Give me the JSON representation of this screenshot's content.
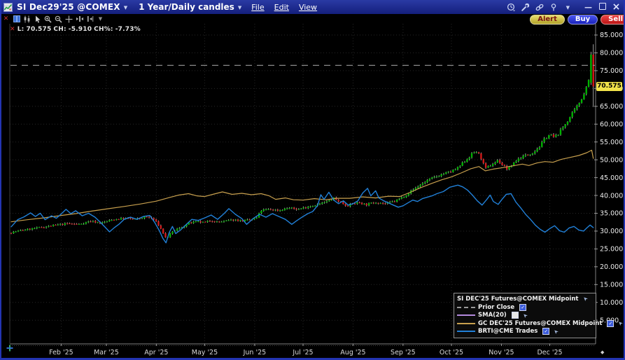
{
  "window": {
    "symbol": "SI Dec29'25 @COMEX",
    "timeframe": "1 Year/Daily candles",
    "menus": [
      "File",
      "Edit",
      "View"
    ],
    "alert_label": "Alert",
    "buy_label": "Buy",
    "sell_label": "Sell"
  },
  "quote": {
    "close_label": "L:",
    "close": "70.575",
    "change_label": "CH:",
    "change": "-5.910",
    "change_pct_label": "CH%:",
    "change_pct": "-7.73%"
  },
  "last_price_tag": "70.575",
  "legend": {
    "title": "SI DEC'25 Futures@COMEX Midpoint",
    "items": [
      {
        "label": "Prior Close",
        "color": "#9a9a9a",
        "dashed": true,
        "checkbox": true,
        "checked": true,
        "arrow": false
      },
      {
        "label": "SMA(20)",
        "color": "#b48ade",
        "dashed": false,
        "checkbox": true,
        "checked": false,
        "arrow": true
      },
      {
        "label": "GC DEC'25 Futures@COMEX Midpoint",
        "color": "#c8a04e",
        "dashed": false,
        "checkbox": true,
        "checked": true,
        "arrow": true
      },
      {
        "label": "BRTI@CME Trades",
        "color": "#2180d8",
        "dashed": false,
        "checkbox": true,
        "checked": true,
        "arrow": true
      }
    ]
  },
  "chart_data": {
    "type": "candlestick",
    "title": "SI Dec29'25 @COMEX - 1 Year/Daily candles",
    "last": 70.575,
    "change": -5.91,
    "change_pct": -7.73,
    "prior_close": 76.485,
    "ylim": [
      0,
      88
    ],
    "y_ticks": [
      85,
      80,
      75,
      70,
      65,
      60,
      55,
      50,
      45,
      40,
      35,
      30,
      25,
      20,
      15,
      10,
      5
    ],
    "x_ticks": [
      {
        "day": 31,
        "label": "Feb '25"
      },
      {
        "day": 59,
        "label": "Mar '25"
      },
      {
        "day": 90,
        "label": "Apr '25"
      },
      {
        "day": 120,
        "label": "May '25"
      },
      {
        "day": 151,
        "label": "Jun '25"
      },
      {
        "day": 181,
        "label": "Jul '25"
      },
      {
        "day": 212,
        "label": "Aug '25"
      },
      {
        "day": 243,
        "label": "Sep '25"
      },
      {
        "day": 273,
        "label": "Oct '25"
      },
      {
        "day": 304,
        "label": "Nov '25"
      },
      {
        "day": 334,
        "label": "Dec '25"
      }
    ],
    "colors": {
      "up": "#00b300",
      "down": "#d21a1a",
      "wick": "#c8c8c8",
      "gc": "#c8a04e",
      "brti": "#2180d8",
      "prior": "#9a9a9a",
      "sma": "#b48ade"
    },
    "si_close_anchors": [
      [
        0,
        29.6
      ],
      [
        6,
        30.2
      ],
      [
        12,
        30.6
      ],
      [
        18,
        31.0
      ],
      [
        24,
        31.4
      ],
      [
        28,
        31.7
      ],
      [
        35,
        32.1
      ],
      [
        42,
        31.9
      ],
      [
        49,
        32.8
      ],
      [
        56,
        32.3
      ],
      [
        63,
        33.2
      ],
      [
        70,
        33.6
      ],
      [
        77,
        33.3
      ],
      [
        84,
        34.0
      ],
      [
        88,
        33.5
      ],
      [
        91,
        32.0
      ],
      [
        94,
        29.7
      ],
      [
        96,
        27.9
      ],
      [
        99,
        29.3
      ],
      [
        102,
        30.4
      ],
      [
        106,
        31.1
      ],
      [
        110,
        32.2
      ],
      [
        115,
        32.6
      ],
      [
        120,
        32.4
      ],
      [
        124,
        33.0
      ],
      [
        128,
        32.5
      ],
      [
        133,
        32.8
      ],
      [
        138,
        33.2
      ],
      [
        143,
        32.9
      ],
      [
        148,
        33.1
      ],
      [
        152,
        33.6
      ],
      [
        155,
        35.8
      ],
      [
        160,
        36.1
      ],
      [
        166,
        35.8
      ],
      [
        172,
        36.5
      ],
      [
        178,
        36.1
      ],
      [
        184,
        36.9
      ],
      [
        190,
        37.4
      ],
      [
        196,
        38.3
      ],
      [
        200,
        39.2
      ],
      [
        204,
        38.2
      ],
      [
        208,
        37.1
      ],
      [
        212,
        37.7
      ],
      [
        216,
        38.0
      ],
      [
        220,
        37.4
      ],
      [
        226,
        38.1
      ],
      [
        232,
        37.7
      ],
      [
        238,
        38.4
      ],
      [
        243,
        39.6
      ],
      [
        248,
        41.2
      ],
      [
        253,
        42.8
      ],
      [
        258,
        44.2
      ],
      [
        263,
        45.2
      ],
      [
        268,
        46.1
      ],
      [
        273,
        46.7
      ],
      [
        277,
        47.7
      ],
      [
        281,
        49.5
      ],
      [
        285,
        51.3
      ],
      [
        288,
        52.5
      ],
      [
        291,
        51.0
      ],
      [
        294,
        47.4
      ],
      [
        298,
        48.7
      ],
      [
        302,
        49.9
      ],
      [
        305,
        48.4
      ],
      [
        308,
        47.2
      ],
      [
        312,
        49.4
      ],
      [
        316,
        50.7
      ],
      [
        320,
        51.4
      ],
      [
        324,
        52.2
      ],
      [
        328,
        53.9
      ],
      [
        331,
        56.0
      ],
      [
        334,
        57.1
      ],
      [
        337,
        56.2
      ],
      [
        340,
        57.8
      ],
      [
        343,
        59.6
      ],
      [
        346,
        61.6
      ],
      [
        349,
        63.6
      ],
      [
        351,
        65.0
      ],
      [
        353,
        66.6
      ],
      [
        355,
        68.4
      ],
      [
        357,
        70.8
      ],
      [
        358,
        72.5
      ],
      [
        359,
        75.5
      ],
      [
        360,
        78.0
      ],
      [
        361,
        70.575
      ]
    ],
    "final_candles": [
      {
        "o": 71.6,
        "h": 80.3,
        "l": 71.0,
        "c": 79.5
      },
      {
        "o": 79.5,
        "h": 82.4,
        "l": 64.8,
        "c": 70.575
      }
    ],
    "gc_line": [
      [
        0,
        32.6
      ],
      [
        10,
        33.2
      ],
      [
        20,
        33.7
      ],
      [
        31,
        34.4
      ],
      [
        40,
        34.9
      ],
      [
        50,
        35.6
      ],
      [
        59,
        36.2
      ],
      [
        70,
        36.9
      ],
      [
        80,
        37.6
      ],
      [
        90,
        38.4
      ],
      [
        98,
        39.4
      ],
      [
        104,
        40.1
      ],
      [
        110,
        40.5
      ],
      [
        115,
        39.9
      ],
      [
        120,
        39.7
      ],
      [
        125,
        40.3
      ],
      [
        131,
        41.0
      ],
      [
        137,
        40.3
      ],
      [
        143,
        40.6
      ],
      [
        149,
        40.2
      ],
      [
        155,
        40.5
      ],
      [
        160,
        39.9
      ],
      [
        164,
        38.9
      ],
      [
        170,
        39.3
      ],
      [
        175,
        38.8
      ],
      [
        181,
        38.7
      ],
      [
        188,
        39.1
      ],
      [
        195,
        38.8
      ],
      [
        202,
        39.2
      ],
      [
        210,
        39.2
      ],
      [
        218,
        39.6
      ],
      [
        226,
        39.3
      ],
      [
        234,
        39.8
      ],
      [
        241,
        39.7
      ],
      [
        247,
        40.8
      ],
      [
        254,
        42.2
      ],
      [
        261,
        43.4
      ],
      [
        267,
        44.4
      ],
      [
        273,
        45.2
      ],
      [
        279,
        46.3
      ],
      [
        285,
        47.5
      ],
      [
        290,
        48.1
      ],
      [
        294,
        46.9
      ],
      [
        299,
        47.4
      ],
      [
        305,
        47.8
      ],
      [
        311,
        48.3
      ],
      [
        317,
        48.8
      ],
      [
        321,
        48.4
      ],
      [
        326,
        49.1
      ],
      [
        331,
        49.5
      ],
      [
        336,
        49.3
      ],
      [
        341,
        50.1
      ],
      [
        347,
        50.7
      ],
      [
        352,
        51.2
      ],
      [
        357,
        52.0
      ],
      [
        360,
        52.7
      ],
      [
        361,
        50.4
      ]
    ],
    "brti_line": [
      [
        0,
        31.2
      ],
      [
        4,
        33.2
      ],
      [
        8,
        34.0
      ],
      [
        12,
        35.1
      ],
      [
        15,
        34.1
      ],
      [
        18,
        35.0
      ],
      [
        21,
        33.2
      ],
      [
        25,
        34.3
      ],
      [
        28,
        33.6
      ],
      [
        31,
        34.8
      ],
      [
        34,
        36.1
      ],
      [
        37,
        34.9
      ],
      [
        40,
        35.7
      ],
      [
        44,
        34.3
      ],
      [
        48,
        35.0
      ],
      [
        52,
        33.9
      ],
      [
        55,
        32.6
      ],
      [
        58,
        31.2
      ],
      [
        61,
        29.8
      ],
      [
        64,
        31.0
      ],
      [
        67,
        32.0
      ],
      [
        70,
        33.3
      ],
      [
        74,
        33.9
      ],
      [
        78,
        33.3
      ],
      [
        82,
        34.1
      ],
      [
        86,
        34.4
      ],
      [
        89,
        32.4
      ],
      [
        92,
        30.0
      ],
      [
        94,
        28.0
      ],
      [
        96,
        26.7
      ],
      [
        98,
        29.6
      ],
      [
        100,
        31.3
      ],
      [
        102,
        29.3
      ],
      [
        105,
        30.3
      ],
      [
        108,
        31.6
      ],
      [
        112,
        33.3
      ],
      [
        116,
        33.0
      ],
      [
        120,
        33.7
      ],
      [
        124,
        34.5
      ],
      [
        128,
        33.3
      ],
      [
        132,
        34.9
      ],
      [
        135,
        36.3
      ],
      [
        139,
        34.7
      ],
      [
        143,
        33.5
      ],
      [
        146,
        31.9
      ],
      [
        150,
        33.5
      ],
      [
        154,
        34.7
      ],
      [
        158,
        33.9
      ],
      [
        162,
        34.9
      ],
      [
        166,
        34.1
      ],
      [
        170,
        33.3
      ],
      [
        174,
        31.9
      ],
      [
        177,
        32.9
      ],
      [
        181,
        34.1
      ],
      [
        184,
        34.9
      ],
      [
        187,
        35.5
      ],
      [
        190,
        37.2
      ],
      [
        192,
        40.2
      ],
      [
        194,
        38.9
      ],
      [
        197,
        40.9
      ],
      [
        200,
        38.7
      ],
      [
        203,
        37.7
      ],
      [
        206,
        38.5
      ],
      [
        209,
        37.3
      ],
      [
        212,
        37.7
      ],
      [
        215,
        38.5
      ],
      [
        218,
        40.7
      ],
      [
        221,
        42.0
      ],
      [
        223,
        39.9
      ],
      [
        226,
        41.3
      ],
      [
        228,
        39.3
      ],
      [
        231,
        38.5
      ],
      [
        234,
        37.9
      ],
      [
        237,
        37.3
      ],
      [
        240,
        36.7
      ],
      [
        243,
        37.1
      ],
      [
        246,
        37.9
      ],
      [
        249,
        38.7
      ],
      [
        252,
        38.3
      ],
      [
        255,
        39.1
      ],
      [
        258,
        39.5
      ],
      [
        261,
        39.9
      ],
      [
        264,
        40.5
      ],
      [
        268,
        41.1
      ],
      [
        272,
        42.3
      ],
      [
        277,
        42.9
      ],
      [
        280,
        42.4
      ],
      [
        283,
        41.5
      ],
      [
        286,
        40.1
      ],
      [
        289,
        38.5
      ],
      [
        292,
        37.3
      ],
      [
        295,
        38.9
      ],
      [
        297,
        40.1
      ],
      [
        299,
        38.3
      ],
      [
        302,
        37.5
      ],
      [
        304,
        38.7
      ],
      [
        307,
        40.3
      ],
      [
        310,
        40.5
      ],
      [
        313,
        38.1
      ],
      [
        316,
        36.5
      ],
      [
        319,
        34.7
      ],
      [
        322,
        33.3
      ],
      [
        325,
        31.7
      ],
      [
        328,
        30.5
      ],
      [
        331,
        29.7
      ],
      [
        334,
        30.7
      ],
      [
        337,
        31.5
      ],
      [
        340,
        30.1
      ],
      [
        343,
        29.7
      ],
      [
        346,
        30.9
      ],
      [
        349,
        31.3
      ],
      [
        352,
        30.3
      ],
      [
        355,
        30.0
      ],
      [
        357,
        30.9
      ],
      [
        359,
        31.7
      ],
      [
        361,
        31.0
      ]
    ]
  }
}
